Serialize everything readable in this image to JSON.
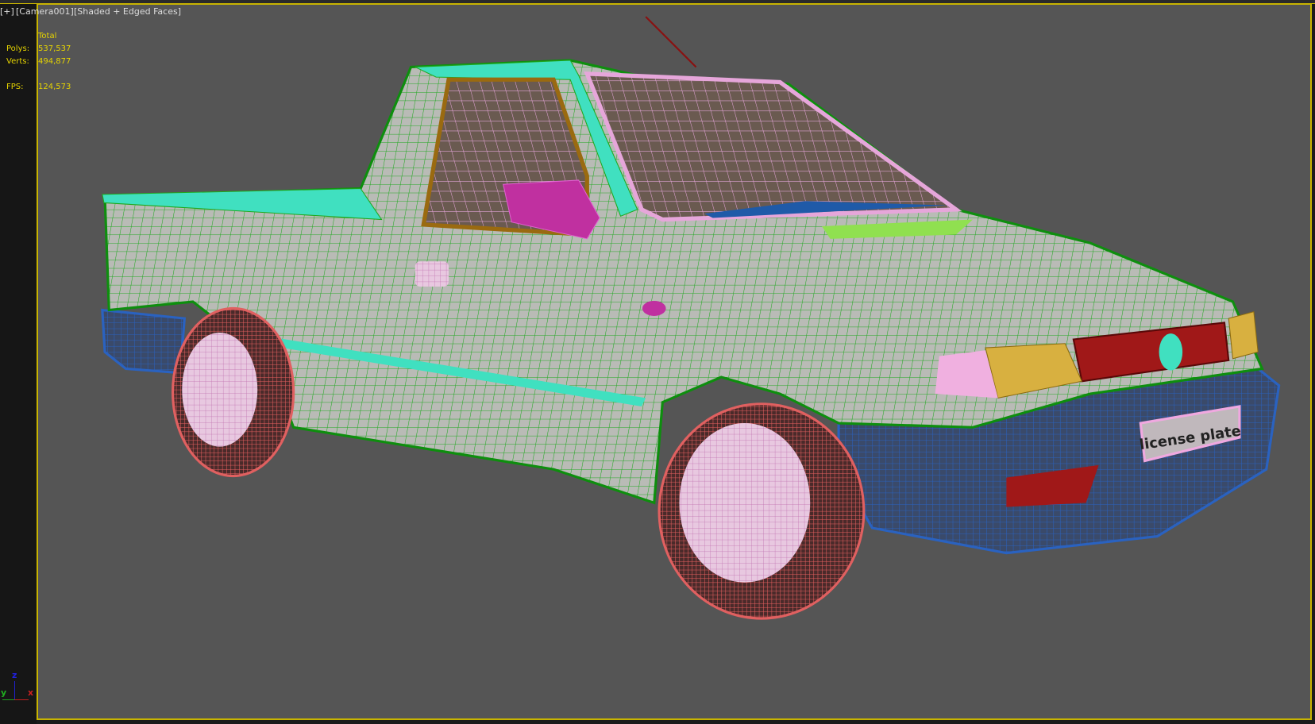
{
  "viewport": {
    "menu_plus": "[+]",
    "camera": "[Camera001]",
    "shading": "[Shaded + Edged Faces]"
  },
  "stats": {
    "header": "Total",
    "polys_label": "Polys:",
    "polys_value": "537,537",
    "verts_label": "Verts:",
    "verts_value": "494,877",
    "fps_label": "FPS:",
    "fps_value": "124,573"
  },
  "axis_gizmo": {
    "x": "x",
    "y": "y",
    "z": "z"
  },
  "model": {
    "license_plate_text": "license plate"
  },
  "colors": {
    "viewport_bg": "#555555",
    "active_border": "#c8b400",
    "stats_text": "#e6d400",
    "body_wire": "#1fa81f",
    "bumper": "#2a62c0",
    "tire": "#e06060",
    "rim": "#f0b0e0",
    "trim": "#40e0c0",
    "headlight": "#d8b040",
    "grille": "#a01818"
  }
}
